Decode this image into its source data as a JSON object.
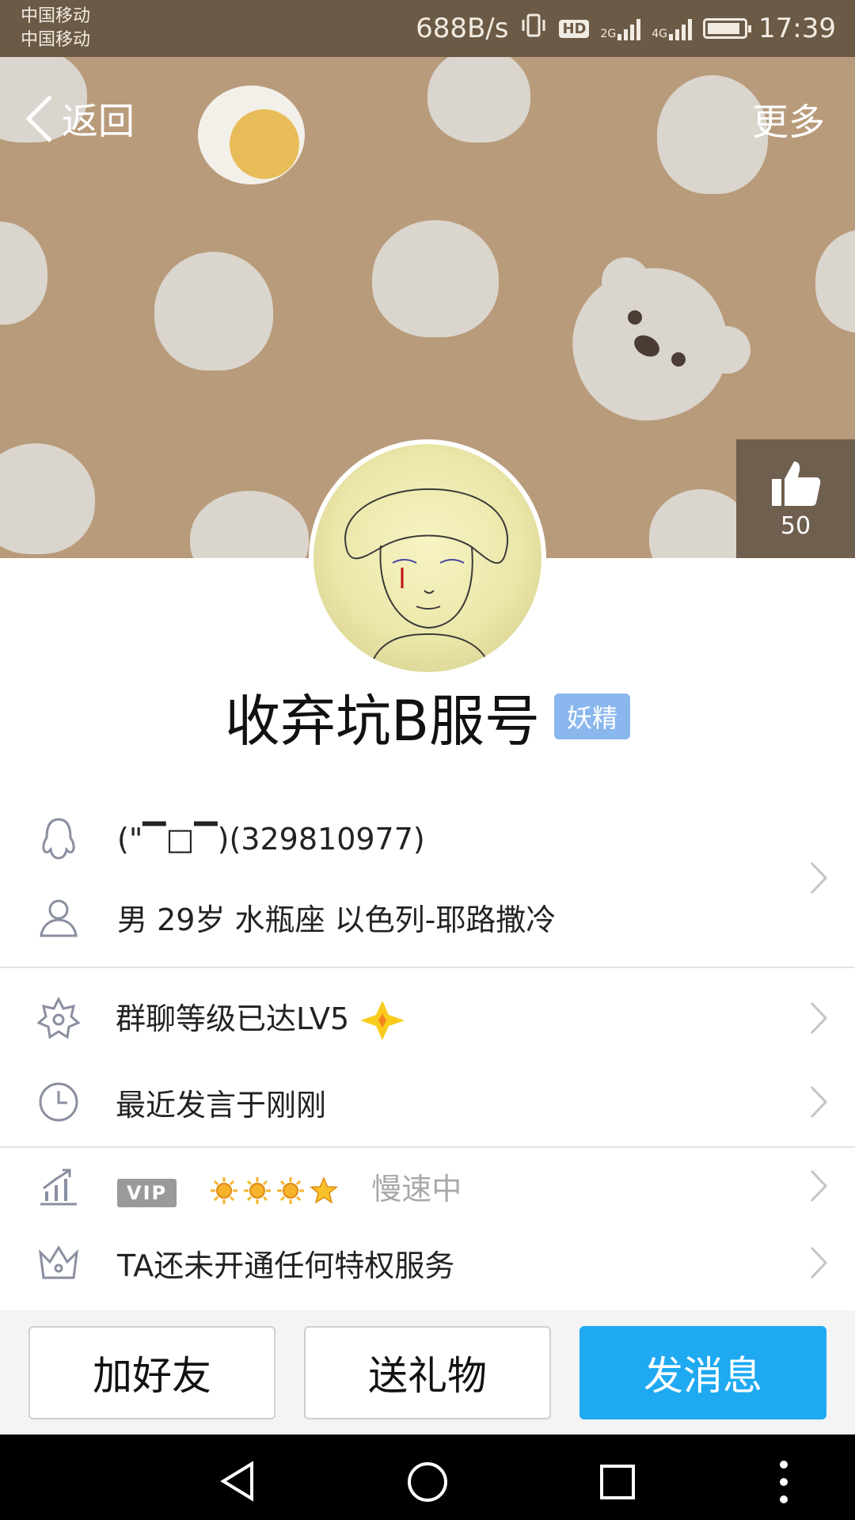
{
  "status_bar": {
    "carrier1": "中国移动",
    "carrier2": "中国移动",
    "speed": "688B/s",
    "hd": "HD",
    "net1": "2G",
    "net2": "4G",
    "time": "17:39"
  },
  "header": {
    "back_label": "返回",
    "more_label": "更多",
    "like_count": "50"
  },
  "profile": {
    "name": "收弃坑B服号",
    "badge": "妖精",
    "qq_line": "(\"▔□▔)(329810977)",
    "details": "男  29岁  水瓶座  以色列-耶路撒冷"
  },
  "list": {
    "group_level": "群聊等级已达LV5",
    "last_speak": "最近发言于刚刚",
    "vip_label": "VIP",
    "vip_status": "慢速中",
    "privilege": "TA还未开通任何特权服务"
  },
  "actions": {
    "add_friend": "加好友",
    "send_gift": "送礼物",
    "send_message": "发消息"
  },
  "colors": {
    "cover_bg": "#b89b7b",
    "primary_button": "#1ea9f1",
    "badge": "#8bb7ef"
  }
}
